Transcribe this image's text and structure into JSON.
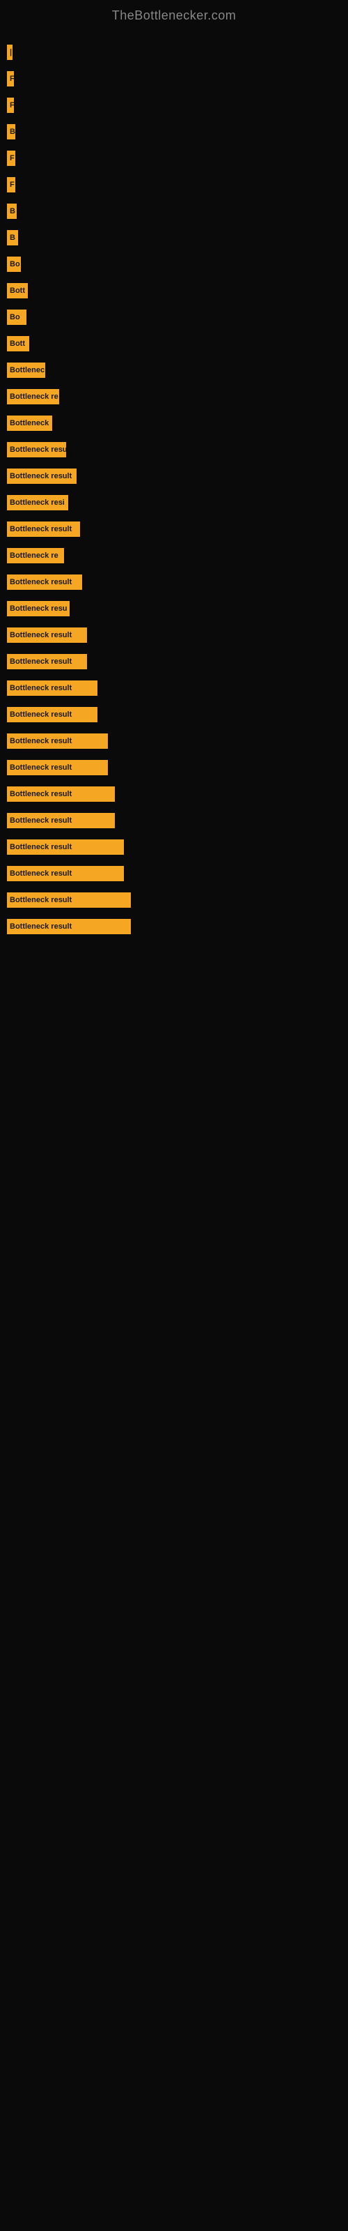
{
  "header": {
    "title": "TheBottlenecker.com"
  },
  "bars": [
    {
      "id": 1,
      "width": 8,
      "label": "|"
    },
    {
      "id": 2,
      "width": 10,
      "label": "F"
    },
    {
      "id": 3,
      "width": 10,
      "label": "F"
    },
    {
      "id": 4,
      "width": 12,
      "label": "B"
    },
    {
      "id": 5,
      "width": 12,
      "label": "F"
    },
    {
      "id": 6,
      "width": 12,
      "label": "F"
    },
    {
      "id": 7,
      "width": 14,
      "label": "B"
    },
    {
      "id": 8,
      "width": 16,
      "label": "B"
    },
    {
      "id": 9,
      "width": 20,
      "label": "Bo"
    },
    {
      "id": 10,
      "width": 30,
      "label": "Bott"
    },
    {
      "id": 11,
      "width": 28,
      "label": "Bo"
    },
    {
      "id": 12,
      "width": 32,
      "label": "Bott"
    },
    {
      "id": 13,
      "width": 55,
      "label": "Bottlenec"
    },
    {
      "id": 14,
      "width": 75,
      "label": "Bottleneck re"
    },
    {
      "id": 15,
      "width": 65,
      "label": "Bottleneck"
    },
    {
      "id": 16,
      "width": 85,
      "label": "Bottleneck resu"
    },
    {
      "id": 17,
      "width": 100,
      "label": "Bottleneck result"
    },
    {
      "id": 18,
      "width": 88,
      "label": "Bottleneck resi"
    },
    {
      "id": 19,
      "width": 105,
      "label": "Bottleneck result"
    },
    {
      "id": 20,
      "width": 82,
      "label": "Bottleneck re"
    },
    {
      "id": 21,
      "width": 108,
      "label": "Bottleneck result"
    },
    {
      "id": 22,
      "width": 90,
      "label": "Bottleneck resu"
    },
    {
      "id": 23,
      "width": 115,
      "label": "Bottleneck result"
    },
    {
      "id": 24,
      "width": 115,
      "label": "Bottleneck result"
    },
    {
      "id": 25,
      "width": 130,
      "label": "Bottleneck result"
    },
    {
      "id": 26,
      "width": 130,
      "label": "Bottleneck result"
    },
    {
      "id": 27,
      "width": 145,
      "label": "Bottleneck result"
    },
    {
      "id": 28,
      "width": 145,
      "label": "Bottleneck result"
    },
    {
      "id": 29,
      "width": 155,
      "label": "Bottleneck result"
    },
    {
      "id": 30,
      "width": 155,
      "label": "Bottleneck result"
    },
    {
      "id": 31,
      "width": 168,
      "label": "Bottleneck result"
    },
    {
      "id": 32,
      "width": 168,
      "label": "Bottleneck result"
    },
    {
      "id": 33,
      "width": 178,
      "label": "Bottleneck result"
    },
    {
      "id": 34,
      "width": 178,
      "label": "Bottleneck result"
    }
  ]
}
